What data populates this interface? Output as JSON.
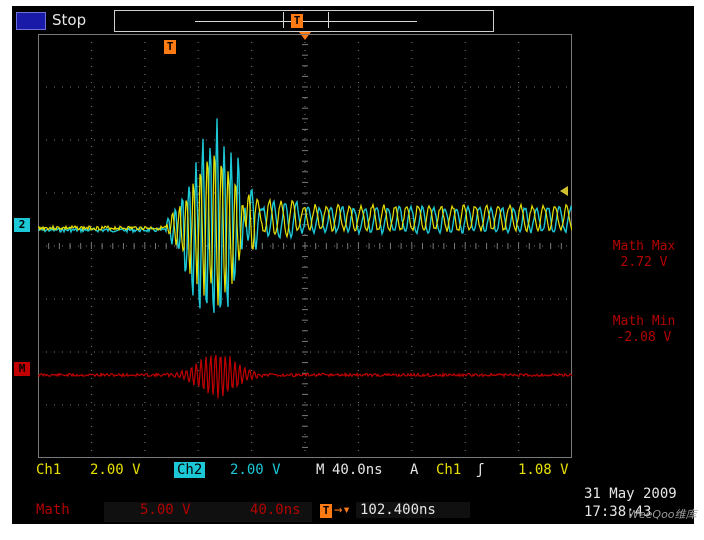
{
  "header": {
    "acquisition_state": "Stop",
    "trigger_marker": "T"
  },
  "graticule": {
    "trigger_marker": "T",
    "channel2_marker": "2",
    "math_marker": "M"
  },
  "measurements": [
    {
      "label": "Math Max",
      "value": "2.72 V"
    },
    {
      "label": "Math Min",
      "value": "-2.08 V"
    }
  ],
  "readout": {
    "ch1_label": "Ch1",
    "ch1_scale": "2.00 V",
    "ch2_label": "Ch2",
    "ch2_scale": "2.00 V",
    "timebase_label": "M",
    "timebase_scale": "40.0ns",
    "trigger_mode": "A",
    "trigger_source": "Ch1",
    "trigger_slope": "ʃ",
    "trigger_level": "1.08 V",
    "math_label": "Math",
    "math_scale": "5.00 V",
    "math_time": "40.0ns",
    "delay_marker": "T",
    "delay_arrow": "→▾",
    "delay_value": "102.400ns",
    "date": "31 May 2009",
    "time": "17:38:43"
  },
  "watermark": "WeeQoo维库",
  "colors": {
    "ch1": "#e8e000",
    "ch2": "#1cc7d6",
    "math": "#c00000",
    "trigger": "#ff7a12",
    "grid": "#7a7a7a"
  }
}
